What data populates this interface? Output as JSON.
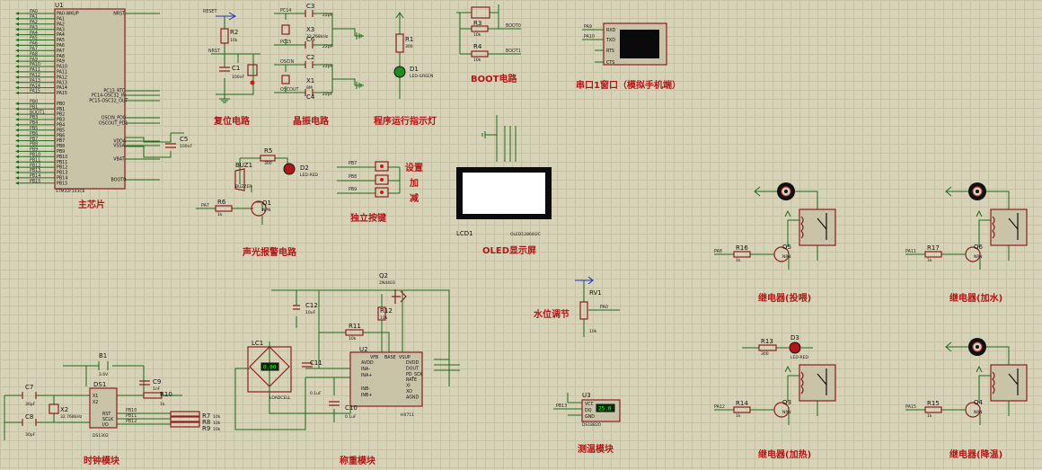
{
  "captions": {
    "main_chip": "主芯片",
    "reset": "复位电路",
    "crystal": "晶振电路",
    "run_led": "程序运行指示灯",
    "boot": "BOOT电路",
    "serial": "串口1窗口（模拟手机端）",
    "alarm": "声光报警电路",
    "keys": "独立按键",
    "key_set": "设置",
    "key_add": "加",
    "key_sub": "减",
    "oled": "OLED显示屏",
    "relay_spray": "继电器(投喂)",
    "relay_water": "继电器(加水)",
    "relay_heat": "继电器(加热)",
    "relay_cool": "继电器(降温)",
    "water": "水位调节",
    "temp": "测温模块",
    "clock": "时钟模块",
    "weigh": "称重模块"
  },
  "mcu": {
    "ref": "U1",
    "part": "STM32F103C6",
    "left_pins": [
      "PA0-WKUP",
      "PA1",
      "PA2",
      "PA3",
      "PA4",
      "PA5",
      "PA6",
      "PA7",
      "PA8",
      "PA9",
      "PA10",
      "PA11",
      "PA12",
      "PA13",
      "PA14",
      "PA15",
      "",
      "PB0",
      "PB1",
      "PB2",
      "PB3",
      "PB4",
      "PB5",
      "PB6",
      "PB7",
      "PB8",
      "PB9",
      "PB10",
      "PB11",
      "PB12",
      "PB13",
      "PB14",
      "PB15"
    ],
    "right_pins": [
      "NRST",
      "PC13_RTC",
      "PC14-OSC32_IN",
      "PC15-OSC32_OUT",
      "OSCIN_PD0",
      "OSCOUT_PD1",
      "VDDA",
      "VSSA",
      "VBAT",
      "BOOT0"
    ],
    "left_nets": [
      "PA0",
      "PA1",
      "PA2",
      "PA3",
      "PA4",
      "PA5",
      "PA6",
      "PA7",
      "PA8",
      "PA9",
      "PA10",
      "PA11",
      "PA12",
      "PA13",
      "PA14",
      "PA15",
      "",
      "PB0",
      "PB1",
      "BOOT1",
      "PB3",
      "PB4",
      "PB5",
      "PB6",
      "PB7",
      "PB8",
      "PB9",
      "PB10",
      "PB11",
      "PB12",
      "PB13",
      "PB14",
      "PB15"
    ]
  },
  "components": {
    "r2": {
      "ref": "R2",
      "val": "10k"
    },
    "c1": {
      "ref": "C1",
      "val": "100nF"
    },
    "nrst": "NRST",
    "reset_net": "RESET",
    "x3": {
      "ref": "X3",
      "val": "32.768kHz"
    },
    "c3": {
      "ref": "C3",
      "val": "22pF"
    },
    "c6": {
      "ref": "C6",
      "val": "22pF"
    },
    "x1": {
      "ref": "X1",
      "val": "8M"
    },
    "c2": {
      "ref": "C2",
      "val": "22pF"
    },
    "c4": {
      "ref": "C4",
      "val": "22pF"
    },
    "pc14": "PC14",
    "pc15": "PC15",
    "oscin": "OSCIN",
    "oscout": "OSCOUT",
    "r1": {
      "ref": "R1",
      "val": "300"
    },
    "d1": {
      "ref": "D1",
      "val": "LED-GREEN"
    },
    "r3": {
      "ref": "R3",
      "val": "10k"
    },
    "r4": {
      "ref": "R4",
      "val": "10k"
    },
    "boot0": "BOOT0",
    "boot1": "BOOT1",
    "serial_pins": [
      "RXD",
      "TXD",
      "RTS",
      "CTS"
    ],
    "serial_nets": [
      "PA9",
      "PA10"
    ],
    "c5": {
      "ref": "C5",
      "val": "100nF"
    },
    "buz1": {
      "ref": "BUZ1",
      "val": "BUZZER"
    },
    "r5": {
      "ref": "R5",
      "val": "300"
    },
    "d2": {
      "ref": "D2",
      "val": "LED-RED"
    },
    "q1": {
      "ref": "Q1",
      "val": "NPN"
    },
    "r6": {
      "ref": "R6",
      "val": "1k"
    },
    "pa7": "PA7",
    "key_nets": [
      "PB7",
      "PB8",
      "PB9"
    ],
    "lcd": {
      "ref": "LCD1",
      "val": "OLED12864I2C"
    },
    "q5": {
      "ref": "Q5",
      "val": "NPN"
    },
    "r16": {
      "ref": "R16",
      "val": "1k"
    },
    "q6": {
      "ref": "Q6",
      "val": "NPN"
    },
    "r17": {
      "ref": "R17",
      "val": "1k"
    },
    "q3": {
      "ref": "Q3",
      "val": "NPN"
    },
    "r14": {
      "ref": "R14",
      "val": "1k"
    },
    "r13": {
      "ref": "R13",
      "val": "300"
    },
    "d3": {
      "ref": "D3",
      "val": "LED-RED"
    },
    "q4": {
      "ref": "Q4",
      "val": "NPN"
    },
    "r15": {
      "ref": "R15",
      "val": "1k"
    },
    "relay_nets": [
      "PA8",
      "PA11",
      "PA12",
      "PA15"
    ],
    "rv1": {
      "ref": "RV1",
      "val": "10k"
    },
    "pa0": "PA0",
    "u3": {
      "ref": "U3",
      "val": "DS18B20",
      "reading": "25.0"
    },
    "u3_pins": [
      "VCC",
      "DQ",
      "GND"
    ],
    "pb13": "PB13",
    "b1": {
      "ref": "B1",
      "val": "3.6V"
    },
    "c7": {
      "ref": "C7",
      "val": "30pF"
    },
    "c8": {
      "ref": "C8",
      "val": "30pF"
    },
    "x2": {
      "ref": "X2",
      "val": "32.768kHz"
    },
    "c9": {
      "ref": "C9",
      "val": "1nF"
    },
    "r10": {
      "ref": "R10",
      "val": "1k"
    },
    "ds1": {
      "ref": "DS1",
      "val": "DS1302"
    },
    "ds1_pins": [
      "X1",
      "X2",
      "RST",
      "SCLK",
      "I/O"
    ],
    "r7": {
      "ref": "R7",
      "val": "10k"
    },
    "r8": {
      "ref": "R8",
      "val": "10k"
    },
    "r9": {
      "ref": "R9",
      "val": "10k"
    },
    "clk_nets": [
      "PB10",
      "PB11",
      "PB12"
    ],
    "lc1": {
      "ref": "LC1",
      "val": "LOADCELL",
      "reading": "0.00"
    },
    "c12": {
      "ref": "C12",
      "val": "10uF"
    },
    "q2": {
      "ref": "Q2",
      "val": "2N4403"
    },
    "r12": {
      "ref": "R12",
      "val": "10k"
    },
    "r11": {
      "ref": "R11",
      "val": "10k"
    },
    "c11": {
      "ref": "C11",
      "val": "0.1uF"
    },
    "c10": {
      "ref": "C10",
      "val": "0.1uF"
    },
    "u2": {
      "ref": "U2",
      "val": "HX711"
    },
    "u2_left": [
      "AVDD",
      "INA-",
      "INA+",
      "INB-",
      "INB+"
    ],
    "u2_top": [
      "VFB",
      "BASE",
      "VSUP"
    ],
    "u2_right": [
      "DVDD",
      "DOUT",
      "PD_SCK",
      "RATE",
      "XI",
      "XO",
      "AGND"
    ]
  },
  "colors": {
    "sheet": "#d6d3b8",
    "grid": "#c6c2a3",
    "wire": "#1e6b1e",
    "part": "#8c1f1f",
    "caption": "#b01818"
  }
}
